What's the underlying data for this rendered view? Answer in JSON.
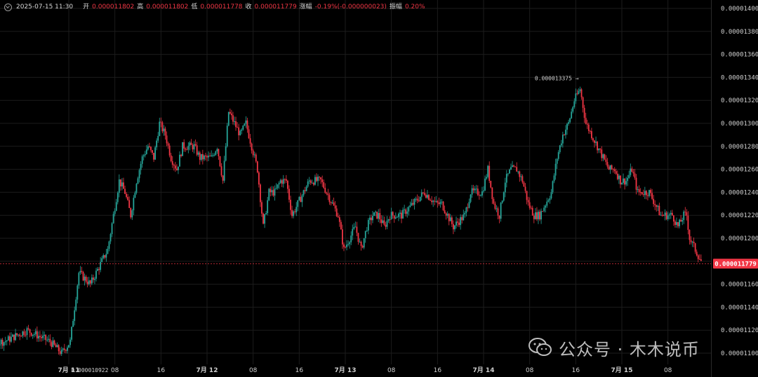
{
  "header": {
    "date": "2025-07-15 11:30",
    "open_label": "开",
    "open": "0.000011802",
    "high_label": "高",
    "high": "0.000011802",
    "low_label": "低",
    "low": "0.000011778",
    "close_label": "收",
    "close": "0.000011779",
    "change_label": "涨幅",
    "change": "-0.19%(-0.000000023)",
    "amplitude_label": "振幅",
    "amplitude": "0.20%"
  },
  "watermark": {
    "text": "公众号 · 木木说币"
  },
  "colors": {
    "up": "#26a69a",
    "down": "#f23645",
    "grid": "#1c1c1c",
    "axis_text": "#cfcfcf",
    "price_tag": "#f23645"
  },
  "chart_data": {
    "type": "candlestick",
    "y_axis": {
      "min": 1.09e-05,
      "max": 1.4e-05,
      "position": "right",
      "ticks": [
        "0.0000140000",
        "0.0000138000",
        "0.0000136000",
        "0.0000134000",
        "0.0000132000",
        "0.0000130000",
        "0.0000128000",
        "0.0000126000",
        "0.0000124000",
        "0.0000122000",
        "0.0000120000",
        "0.0000118000",
        "0.0000116000",
        "0.0000114000",
        "0.0000112000",
        "0.0000110000"
      ],
      "tick_values": [
        1.4e-05,
        1.38e-05,
        1.36e-05,
        1.34e-05,
        1.32e-05,
        1.3e-05,
        1.28e-05,
        1.26e-05,
        1.24e-05,
        1.22e-05,
        1.2e-05,
        1.18e-05,
        1.16e-05,
        1.14e-05,
        1.12e-05,
        1.1e-05
      ]
    },
    "x_axis": {
      "ticks": [
        "7月 11",
        "08",
        "16",
        "7月 12",
        "08",
        "16",
        "7月 13",
        "08",
        "16",
        "7月 14",
        "08",
        "16",
        "7月 15",
        "08"
      ],
      "bold": [
        true,
        false,
        false,
        true,
        false,
        false,
        true,
        false,
        false,
        true,
        false,
        false,
        true,
        false
      ],
      "tick_hours": [
        24,
        32,
        40,
        48,
        56,
        64,
        72,
        80,
        88,
        96,
        104,
        112,
        120,
        128
      ],
      "hour_range": [
        5,
        134
      ]
    },
    "price_path": [
      [
        5,
        1.1e-05
      ],
      [
        9,
        1.11e-05
      ],
      [
        13,
        1.11e-05
      ],
      [
        17,
        1.12e-05
      ],
      [
        21,
        1.11e-05
      ],
      [
        23,
        1.1e-05
      ],
      [
        24.5,
        1.11e-05
      ],
      [
        26,
        1.17e-05
      ],
      [
        28,
        1.16e-05
      ],
      [
        30,
        1.18e-05
      ],
      [
        31,
        1.19e-05
      ],
      [
        32,
        1.22e-05
      ],
      [
        33,
        1.25e-05
      ],
      [
        34,
        1.24e-05
      ],
      [
        35,
        1.22e-05
      ],
      [
        36,
        1.25e-05
      ],
      [
        37,
        1.27e-05
      ],
      [
        38,
        1.28e-05
      ],
      [
        39,
        1.27e-05
      ],
      [
        40,
        1.3e-05
      ],
      [
        41,
        1.29e-05
      ],
      [
        42,
        1.27e-05
      ],
      [
        43,
        1.26e-05
      ],
      [
        44,
        1.28e-05
      ],
      [
        46,
        1.28e-05
      ],
      [
        47,
        1.27e-05
      ],
      [
        49,
        1.27e-05
      ],
      [
        50,
        1.28e-05
      ],
      [
        51,
        1.25e-05
      ],
      [
        52,
        1.31e-05
      ],
      [
        53,
        1.3e-05
      ],
      [
        54,
        1.29e-05
      ],
      [
        55,
        1.3e-05
      ],
      [
        56,
        1.28e-05
      ],
      [
        57,
        1.26e-05
      ],
      [
        58,
        1.21e-05
      ],
      [
        59,
        1.24e-05
      ],
      [
        60,
        1.24e-05
      ],
      [
        61,
        1.25e-05
      ],
      [
        62,
        1.25e-05
      ],
      [
        63,
        1.22e-05
      ],
      [
        65,
        1.24e-05
      ],
      [
        66,
        1.25e-05
      ],
      [
        68,
        1.25e-05
      ],
      [
        69,
        1.24e-05
      ],
      [
        70,
        1.23e-05
      ],
      [
        71,
        1.22e-05
      ],
      [
        72,
        1.19e-05
      ],
      [
        73,
        1.2e-05
      ],
      [
        74,
        1.21e-05
      ],
      [
        75,
        1.19e-05
      ],
      [
        76,
        1.21e-05
      ],
      [
        77,
        1.22e-05
      ],
      [
        78,
        1.22e-05
      ],
      [
        79,
        1.21e-05
      ],
      [
        80,
        1.22e-05
      ],
      [
        82,
        1.22e-05
      ],
      [
        84,
        1.23e-05
      ],
      [
        86,
        1.24e-05
      ],
      [
        88,
        1.23e-05
      ],
      [
        89,
        1.23e-05
      ],
      [
        90,
        1.22e-05
      ],
      [
        91,
        1.21e-05
      ],
      [
        93,
        1.22e-05
      ],
      [
        94,
        1.24e-05
      ],
      [
        96,
        1.24e-05
      ],
      [
        97,
        1.26e-05
      ],
      [
        98,
        1.23e-05
      ],
      [
        99,
        1.22e-05
      ],
      [
        100,
        1.25e-05
      ],
      [
        101,
        1.26e-05
      ],
      [
        102,
        1.26e-05
      ],
      [
        103,
        1.25e-05
      ],
      [
        104,
        1.23e-05
      ],
      [
        105,
        1.22e-05
      ],
      [
        106,
        1.22e-05
      ],
      [
        107,
        1.23e-05
      ],
      [
        108,
        1.24e-05
      ],
      [
        109,
        1.27e-05
      ],
      [
        110,
        1.29e-05
      ],
      [
        111,
        1.3e-05
      ],
      [
        112,
        1.32e-05
      ],
      [
        113,
        1.33e-05
      ],
      [
        114,
        1.3e-05
      ],
      [
        115,
        1.29e-05
      ],
      [
        116,
        1.28e-05
      ],
      [
        117,
        1.27e-05
      ],
      [
        118,
        1.26e-05
      ],
      [
        119,
        1.26e-05
      ],
      [
        120,
        1.25e-05
      ],
      [
        121,
        1.25e-05
      ],
      [
        122,
        1.26e-05
      ],
      [
        123,
        1.24e-05
      ],
      [
        124,
        1.24e-05
      ],
      [
        125,
        1.24e-05
      ],
      [
        126,
        1.23e-05
      ],
      [
        127,
        1.22e-05
      ],
      [
        128,
        1.22e-05
      ],
      [
        129,
        1.22e-05
      ],
      [
        130,
        1.21e-05
      ],
      [
        131,
        1.22e-05
      ],
      [
        131.5,
        1.22e-05
      ],
      [
        132,
        1.2e-05
      ],
      [
        133,
        1.19e-05
      ],
      [
        134,
        1.18e-05
      ]
    ],
    "markers": [
      {
        "hour": 113,
        "price": 1.3375e-05,
        "label": "0.000013375 →",
        "side": "left"
      },
      {
        "hour": 23,
        "price": 1.0922e-05,
        "label": "← 0.000010922",
        "side": "right"
      }
    ],
    "last_price": {
      "value": 1.1779e-05,
      "label": "0.000011779"
    }
  }
}
